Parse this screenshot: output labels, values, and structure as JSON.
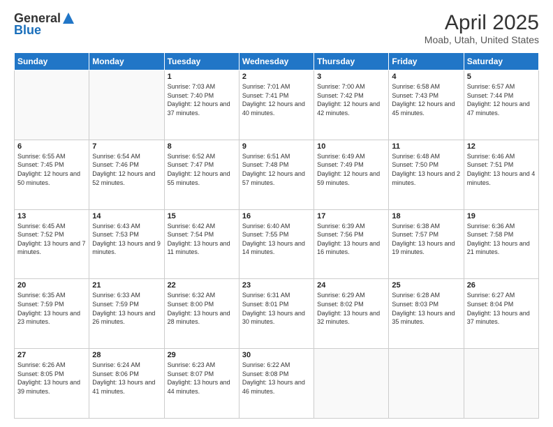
{
  "header": {
    "logo_general": "General",
    "logo_blue": "Blue",
    "title": "April 2025",
    "subtitle": "Moab, Utah, United States"
  },
  "calendar": {
    "days_of_week": [
      "Sunday",
      "Monday",
      "Tuesday",
      "Wednesday",
      "Thursday",
      "Friday",
      "Saturday"
    ],
    "weeks": [
      [
        {
          "day": "",
          "info": ""
        },
        {
          "day": "",
          "info": ""
        },
        {
          "day": "1",
          "info": "Sunrise: 7:03 AM\nSunset: 7:40 PM\nDaylight: 12 hours and 37 minutes."
        },
        {
          "day": "2",
          "info": "Sunrise: 7:01 AM\nSunset: 7:41 PM\nDaylight: 12 hours and 40 minutes."
        },
        {
          "day": "3",
          "info": "Sunrise: 7:00 AM\nSunset: 7:42 PM\nDaylight: 12 hours and 42 minutes."
        },
        {
          "day": "4",
          "info": "Sunrise: 6:58 AM\nSunset: 7:43 PM\nDaylight: 12 hours and 45 minutes."
        },
        {
          "day": "5",
          "info": "Sunrise: 6:57 AM\nSunset: 7:44 PM\nDaylight: 12 hours and 47 minutes."
        }
      ],
      [
        {
          "day": "6",
          "info": "Sunrise: 6:55 AM\nSunset: 7:45 PM\nDaylight: 12 hours and 50 minutes."
        },
        {
          "day": "7",
          "info": "Sunrise: 6:54 AM\nSunset: 7:46 PM\nDaylight: 12 hours and 52 minutes."
        },
        {
          "day": "8",
          "info": "Sunrise: 6:52 AM\nSunset: 7:47 PM\nDaylight: 12 hours and 55 minutes."
        },
        {
          "day": "9",
          "info": "Sunrise: 6:51 AM\nSunset: 7:48 PM\nDaylight: 12 hours and 57 minutes."
        },
        {
          "day": "10",
          "info": "Sunrise: 6:49 AM\nSunset: 7:49 PM\nDaylight: 12 hours and 59 minutes."
        },
        {
          "day": "11",
          "info": "Sunrise: 6:48 AM\nSunset: 7:50 PM\nDaylight: 13 hours and 2 minutes."
        },
        {
          "day": "12",
          "info": "Sunrise: 6:46 AM\nSunset: 7:51 PM\nDaylight: 13 hours and 4 minutes."
        }
      ],
      [
        {
          "day": "13",
          "info": "Sunrise: 6:45 AM\nSunset: 7:52 PM\nDaylight: 13 hours and 7 minutes."
        },
        {
          "day": "14",
          "info": "Sunrise: 6:43 AM\nSunset: 7:53 PM\nDaylight: 13 hours and 9 minutes."
        },
        {
          "day": "15",
          "info": "Sunrise: 6:42 AM\nSunset: 7:54 PM\nDaylight: 13 hours and 11 minutes."
        },
        {
          "day": "16",
          "info": "Sunrise: 6:40 AM\nSunset: 7:55 PM\nDaylight: 13 hours and 14 minutes."
        },
        {
          "day": "17",
          "info": "Sunrise: 6:39 AM\nSunset: 7:56 PM\nDaylight: 13 hours and 16 minutes."
        },
        {
          "day": "18",
          "info": "Sunrise: 6:38 AM\nSunset: 7:57 PM\nDaylight: 13 hours and 19 minutes."
        },
        {
          "day": "19",
          "info": "Sunrise: 6:36 AM\nSunset: 7:58 PM\nDaylight: 13 hours and 21 minutes."
        }
      ],
      [
        {
          "day": "20",
          "info": "Sunrise: 6:35 AM\nSunset: 7:59 PM\nDaylight: 13 hours and 23 minutes."
        },
        {
          "day": "21",
          "info": "Sunrise: 6:33 AM\nSunset: 7:59 PM\nDaylight: 13 hours and 26 minutes."
        },
        {
          "day": "22",
          "info": "Sunrise: 6:32 AM\nSunset: 8:00 PM\nDaylight: 13 hours and 28 minutes."
        },
        {
          "day": "23",
          "info": "Sunrise: 6:31 AM\nSunset: 8:01 PM\nDaylight: 13 hours and 30 minutes."
        },
        {
          "day": "24",
          "info": "Sunrise: 6:29 AM\nSunset: 8:02 PM\nDaylight: 13 hours and 32 minutes."
        },
        {
          "day": "25",
          "info": "Sunrise: 6:28 AM\nSunset: 8:03 PM\nDaylight: 13 hours and 35 minutes."
        },
        {
          "day": "26",
          "info": "Sunrise: 6:27 AM\nSunset: 8:04 PM\nDaylight: 13 hours and 37 minutes."
        }
      ],
      [
        {
          "day": "27",
          "info": "Sunrise: 6:26 AM\nSunset: 8:05 PM\nDaylight: 13 hours and 39 minutes."
        },
        {
          "day": "28",
          "info": "Sunrise: 6:24 AM\nSunset: 8:06 PM\nDaylight: 13 hours and 41 minutes."
        },
        {
          "day": "29",
          "info": "Sunrise: 6:23 AM\nSunset: 8:07 PM\nDaylight: 13 hours and 44 minutes."
        },
        {
          "day": "30",
          "info": "Sunrise: 6:22 AM\nSunset: 8:08 PM\nDaylight: 13 hours and 46 minutes."
        },
        {
          "day": "",
          "info": ""
        },
        {
          "day": "",
          "info": ""
        },
        {
          "day": "",
          "info": ""
        }
      ]
    ]
  }
}
